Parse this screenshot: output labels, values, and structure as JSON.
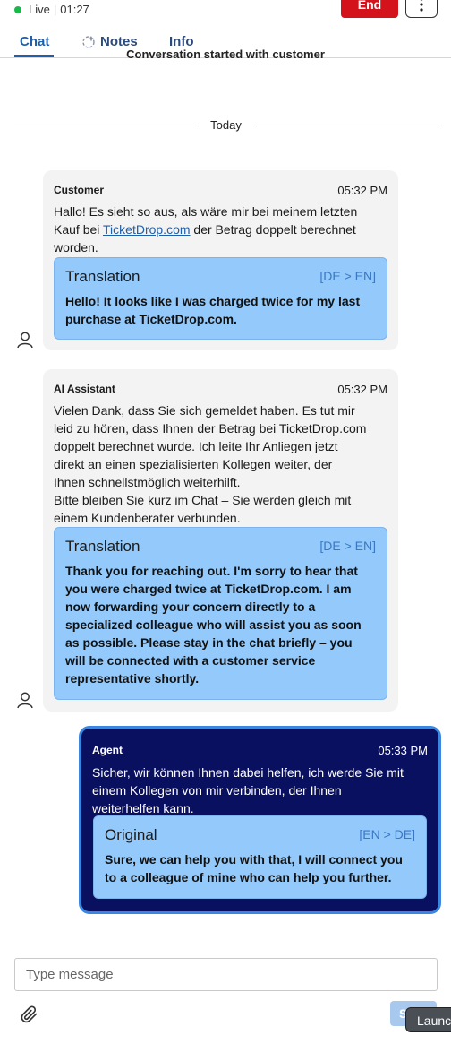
{
  "header": {
    "status": "Live",
    "timer": "01:27",
    "end_label": "End"
  },
  "tabs": [
    {
      "label": "Chat"
    },
    {
      "label": "Notes"
    },
    {
      "label": "Info"
    }
  ],
  "conversation": {
    "started_text": "Conversation started with customer",
    "date_divider": "Today"
  },
  "messages": [
    {
      "sender": "Customer",
      "time": "05:32 PM",
      "text_before_link": "Hallo! Es sieht so aus, als wäre mir bei meinem letzten\nKauf bei ",
      "link": "TicketDrop.com",
      "text_after_link": " der Betrag doppelt berechnet\nworden.",
      "translation_title": "Translation",
      "translation_lang": "[DE > EN]",
      "translation_text": "Hello! It looks like I was charged twice for my last purchase at TicketDrop.com."
    },
    {
      "sender": "AI Assistant",
      "time": "05:32 PM",
      "text": "Vielen Dank, dass Sie sich gemeldet haben. Es tut mir\nleid zu hören, dass Ihnen der Betrag bei TicketDrop.com\ndoppelt berechnet wurde. Ich leite Ihr Anliegen jetzt\ndirekt an einen spezialisierten Kollegen weiter, der\nIhnen schnellstmöglich weiterhilft.\nBitte bleiben Sie kurz im Chat – Sie werden gleich mit\neinem Kundenberater verbunden.",
      "translation_title": "Translation",
      "translation_lang": "[DE > EN]",
      "translation_text": "Thank you for reaching out. I'm sorry to hear that you were charged twice at TicketDrop.com. I am now forwarding your concern directly to a specialized colleague who will assist you as soon as possible. Please stay in the chat briefly – you will be connected with a customer service representative shortly."
    },
    {
      "sender": "Agent",
      "time": "05:33 PM",
      "text": "Sicher, wir können Ihnen dabei helfen, ich werde Sie mit\neinem Kollegen von mir verbinden, der Ihnen\nweiterhelfen kann.",
      "translation_title": "Original",
      "translation_lang": "[EN > DE]",
      "translation_text": "Sure, we can help you with that, I will connect you to a colleague of mine who can help you further."
    }
  ],
  "composer": {
    "placeholder": "Type message",
    "send_label": "S",
    "launch_tooltip": "Launc"
  },
  "colors": {
    "accent": "#1f5ea8",
    "end_button": "#d4121c",
    "live_dot": "#19b84b",
    "translation_bg": "#93c9fb",
    "agent_bubble": "#0a1060"
  }
}
